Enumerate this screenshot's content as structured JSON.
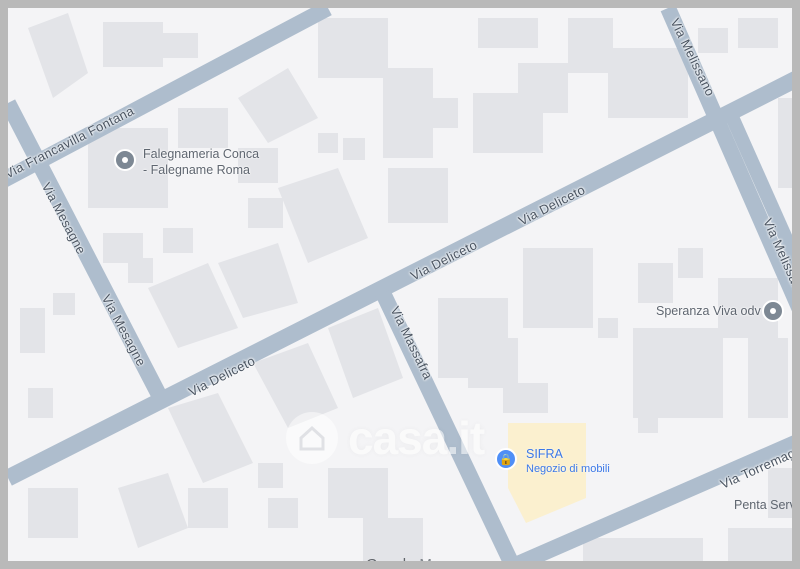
{
  "map": {
    "roads": [
      {
        "id": "via-francavilla-fontana",
        "label": "Via Francavilla Fontana"
      },
      {
        "id": "via-mesagne-upper",
        "label": "Via Mesagne"
      },
      {
        "id": "via-mesagne-lower",
        "label": "Via Mesagne"
      },
      {
        "id": "via-deliceto-1",
        "label": "Via Deliceto"
      },
      {
        "id": "via-deliceto-2",
        "label": "Via Deliceto"
      },
      {
        "id": "via-deliceto-3",
        "label": "Via Deliceto"
      },
      {
        "id": "via-massafra",
        "label": "Via Massafra"
      },
      {
        "id": "via-melissano-top",
        "label": "Via Melissano"
      },
      {
        "id": "via-melissano-right",
        "label": "Via Melissano"
      },
      {
        "id": "via-torremaggiore",
        "label": "Via Torremag"
      }
    ],
    "pois": {
      "falegnameria": {
        "line1": "Falegnameria Conca",
        "line2": "- Falegname Roma"
      },
      "speranza": {
        "label": "Speranza Viva odv"
      },
      "sifra": {
        "name": "SIFRA",
        "category": "Negozio di mobili"
      },
      "penta": {
        "label": "Penta Servic"
      }
    },
    "watermark": {
      "text": "casa.it"
    },
    "attribution": {
      "google": "Google",
      "maps": "Maps"
    },
    "colors": {
      "background": "#f4f4f6",
      "road": "#aebdcd",
      "building": "#e3e4e8",
      "poi_pin": "#7d8894",
      "sifra_pin": "#4f8ff7",
      "highlight_parcel": "#fbf0cf",
      "frame": "#b9b9b9"
    }
  }
}
